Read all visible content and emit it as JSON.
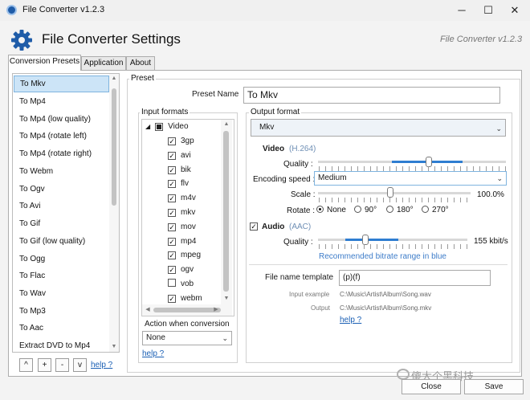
{
  "window": {
    "title": "File Converter v1.2.3",
    "controls": {
      "minimize": "─",
      "maximize": "☐",
      "close": "✕"
    }
  },
  "header": {
    "title": "File Converter Settings",
    "version": "File Converter v1.2.3",
    "icon": "gear-icon",
    "accent": "#1f5ca8"
  },
  "tabs": [
    {
      "label": "Conversion Presets",
      "active": true
    },
    {
      "label": "Application",
      "active": false
    },
    {
      "label": "About",
      "active": false
    }
  ],
  "presets": {
    "selected": "To Mkv",
    "items": [
      "To Mkv",
      "To Mp4",
      "To Mp4 (low quality)",
      "To Mp4 (rotate left)",
      "To Mp4 (rotate right)",
      "To Webm",
      "To Ogv",
      "To Avi",
      "To Gif",
      "To Gif (low quality)",
      "To Ogg",
      "To Flac",
      "To Wav",
      "To Mp3",
      "To Aac",
      "Extract DVD to Mp4"
    ],
    "buttons": {
      "up": "^",
      "add": "+",
      "remove": "-",
      "down": "v"
    },
    "help": "help ?"
  },
  "preset": {
    "group_label": "Preset",
    "name_label": "Preset Name",
    "name_value": "To Mkv"
  },
  "input_formats": {
    "label": "Input formats",
    "category": "Video",
    "formats": [
      {
        "name": "3gp",
        "checked": true
      },
      {
        "name": "avi",
        "checked": true
      },
      {
        "name": "bik",
        "checked": true
      },
      {
        "name": "flv",
        "checked": true
      },
      {
        "name": "m4v",
        "checked": true
      },
      {
        "name": "mkv",
        "checked": true
      },
      {
        "name": "mov",
        "checked": true
      },
      {
        "name": "mp4",
        "checked": true
      },
      {
        "name": "mpeg",
        "checked": true
      },
      {
        "name": "ogv",
        "checked": true
      },
      {
        "name": "vob",
        "checked": false
      },
      {
        "name": "webm",
        "checked": true
      }
    ],
    "action_label": "Action when conversion",
    "action_value": "None",
    "help": "help ?"
  },
  "output": {
    "label": "Output format",
    "format": "Mkv",
    "video": {
      "label": "Video",
      "codec": "(H.264)",
      "quality_label": "Quality :",
      "encoding_label": "Encoding speed :",
      "encoding_value": "Medium",
      "scale_label": "Scale :",
      "scale_value": "100.0%",
      "rotate_label": "Rotate :",
      "rotate_options": [
        "None",
        "90°",
        "180°",
        "270°"
      ],
      "rotate_selected": "None"
    },
    "audio": {
      "label": "Audio",
      "codec": "(AAC)",
      "enabled": true,
      "quality_label": "Quality :",
      "quality_value": "155 kbit/s",
      "hint": "Recommended bitrate range in blue"
    },
    "filename": {
      "label": "File name template",
      "value": "(p)(f)",
      "input_example_label": "Input example",
      "input_example_value": "C:\\Music\\Artist\\Album\\Song.wav",
      "output_label": "Output",
      "output_value": "C:\\Music\\Artist\\Album\\Song.mkv",
      "help": "help ?"
    }
  },
  "footer": {
    "watermark": "傻大个黑科技",
    "close": "Close",
    "save": "Save"
  }
}
